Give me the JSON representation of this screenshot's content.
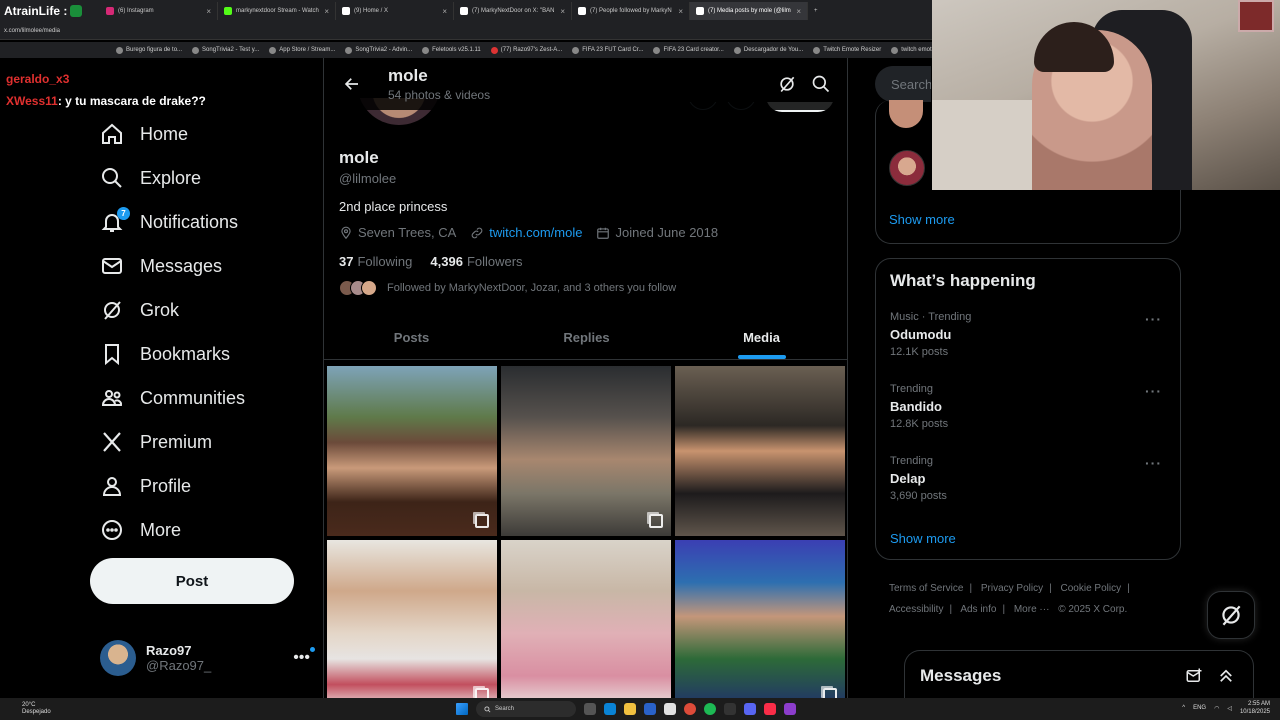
{
  "browser": {
    "brand": "AtrainLife :",
    "url": "x.com/lilmolee/media",
    "tabs": [
      {
        "title": "(6) Instagram",
        "color": "#d62976",
        "active": false
      },
      {
        "title": "markynextdoor Stream - Watch",
        "color": "#53fc18",
        "active": false
      },
      {
        "title": "(9) Home / X",
        "color": "#ffffff",
        "active": false
      },
      {
        "title": "(7) MarkyNextDoor on X: \"BAN",
        "color": "#ffffff",
        "active": false
      },
      {
        "title": "(7) People followed by MarkyN",
        "color": "#ffffff",
        "active": false
      },
      {
        "title": "(7) Media posts by mole (@lilm",
        "color": "#ffffff",
        "active": true
      }
    ],
    "bookmarks": [
      "Burego figura de to...",
      "SongTrivia2 - Test y...",
      "App Store / Stream...",
      "SongTrivia2 - Advin...",
      "Feletools v25.1.11",
      "(77) Razo97's Zest-A...",
      "FIFA 23 FUT Card Cr...",
      "FIFA 23 Card creator...",
      "Descargador de You...",
      "Twitch Emote Resizer",
      "twitch emote resizer..."
    ]
  },
  "chat": {
    "line1_user": "geraldo_x3",
    "line2_user": "XWess11",
    "line2_msg": ": y tu mascara de drake??"
  },
  "nav": {
    "items": [
      {
        "label": "Home",
        "icon": "home-icon"
      },
      {
        "label": "Explore",
        "icon": "search-icon"
      },
      {
        "label": "Notifications",
        "icon": "bell-icon",
        "badge": "7"
      },
      {
        "label": "Messages",
        "icon": "mail-icon"
      },
      {
        "label": "Grok",
        "icon": "grok-icon"
      },
      {
        "label": "Bookmarks",
        "icon": "bookmark-icon"
      },
      {
        "label": "Communities",
        "icon": "people-icon"
      },
      {
        "label": "Premium",
        "icon": "x-logo-icon"
      },
      {
        "label": "Profile",
        "icon": "person-icon"
      },
      {
        "label": "More",
        "icon": "more-circle-icon"
      }
    ],
    "post_label": "Post",
    "account": {
      "name": "Razo97",
      "handle": "@Razo97_"
    }
  },
  "profile": {
    "top_name": "mole",
    "top_sub": "54 photos & videos",
    "name": "mole",
    "handle": "@lilmolee",
    "bio": "2nd place princess",
    "location": "Seven Trees, CA",
    "link": "twitch.com/mole",
    "joined": "Joined June 2018",
    "following_count": "37",
    "following_label": "Following",
    "followers_count": "4,396",
    "followers_label": "Followers",
    "followed_by": "Followed by MarkyNextDoor, Jozar, and 3 others you follow",
    "tabs": [
      "Posts",
      "Replies",
      "Media"
    ],
    "active_tab": "Media"
  },
  "right": {
    "search_placeholder": "Search",
    "who_show_more": "Show more",
    "trending_title": "What’s happening",
    "trends": [
      {
        "category": "Music · Trending",
        "name": "Odumodu",
        "count": "12.1K posts"
      },
      {
        "category": "Trending",
        "name": "Bandido",
        "count": "12.8K posts"
      },
      {
        "category": "Trending",
        "name": "Delap",
        "count": "3,690 posts"
      }
    ],
    "trending_show_more": "Show more",
    "footer": {
      "terms": "Terms of Service",
      "privacy": "Privacy Policy",
      "cookie": "Cookie Policy",
      "accessibility": "Accessibility",
      "ads": "Ads info",
      "more": "More ···",
      "copyright": "© 2025 X Corp."
    },
    "messages_title": "Messages"
  },
  "taskbar": {
    "temp": "20°C",
    "weather": "Despejado",
    "search": "Search",
    "lang": "ENG",
    "time": "2:55 AM",
    "date": "10/18/2025"
  }
}
